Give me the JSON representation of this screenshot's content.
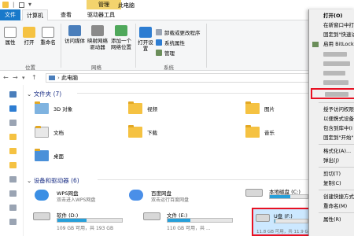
{
  "window": {
    "title": "此电脑",
    "context_tab": "管理"
  },
  "tabs": [
    {
      "label": "文件"
    },
    {
      "label": "计算机"
    },
    {
      "label": "查看"
    },
    {
      "label": "驱动器工具"
    }
  ],
  "ribbon": {
    "buttons": [
      {
        "label": "属性"
      },
      {
        "label": "打开"
      },
      {
        "label": "重命名"
      },
      {
        "label": "访问媒体"
      },
      {
        "label": "映射网络驱动器"
      },
      {
        "label": "添加一个网络位置"
      },
      {
        "label": "打开设置"
      }
    ],
    "small_items": [
      {
        "label": "卸载或更改程序"
      },
      {
        "label": "系统属性"
      },
      {
        "label": "管理"
      }
    ],
    "groups": [
      {
        "label": "位置"
      },
      {
        "label": "网络"
      },
      {
        "label": "系统"
      }
    ]
  },
  "address": {
    "path": "此电脑"
  },
  "sections": {
    "folders": "文件夹 (7)",
    "devices": "设备和驱动器 (6)"
  },
  "folders": [
    {
      "label": "3D 对象"
    },
    {
      "label": "视频"
    },
    {
      "label": "图片"
    },
    {
      "label": "文档"
    },
    {
      "label": "下载"
    },
    {
      "label": "音乐"
    },
    {
      "label": "桌面"
    }
  ],
  "devices": [
    {
      "name": "WPS网盘",
      "sub": "双击进入WPS网盘"
    },
    {
      "name": "百度网盘",
      "sub": "双击运行百度网盘"
    },
    {
      "name": "本地磁盘 (C:)",
      "used_fraction": 0.55,
      "size": "…"
    },
    {
      "name": "软件 (D:)",
      "used_fraction": 0.45,
      "size": "109 GB 可用，共 193 GB"
    },
    {
      "name": "文件 (E:)",
      "used_fraction": 0.35,
      "size": "110 GB 可用，共 ..."
    },
    {
      "name": "U盘 (F:)",
      "used_fraction": 0.02,
      "size": "11.8 GB 可用，共 11.9 GB"
    }
  ],
  "context_menu": {
    "items": [
      {
        "label": "打开(O)",
        "bold": true
      },
      {
        "label": "在新窗口中打"
      },
      {
        "label": "固定到\"快速访"
      },
      {
        "label": "启用 BitLock"
      },
      {
        "label": "授予访问权限"
      },
      {
        "label": "以便携式设备"
      },
      {
        "label": "包含到库中(I"
      },
      {
        "label": "固定到\"开始\""
      },
      {
        "label": "格式化(A)..."
      },
      {
        "label": "弹出(J)"
      },
      {
        "label": "剪切(T)"
      },
      {
        "label": "复制(C)"
      },
      {
        "label": "创建快捷方式"
      },
      {
        "label": "重命名(M)"
      },
      {
        "label": "属性(R)"
      }
    ]
  },
  "colors": {
    "file_tab": "#1979ca",
    "manage_tab": "#f3d36d",
    "selection": "#cce8ff",
    "highlight_box": "#e81123",
    "drive_bar": "#26a0da"
  }
}
